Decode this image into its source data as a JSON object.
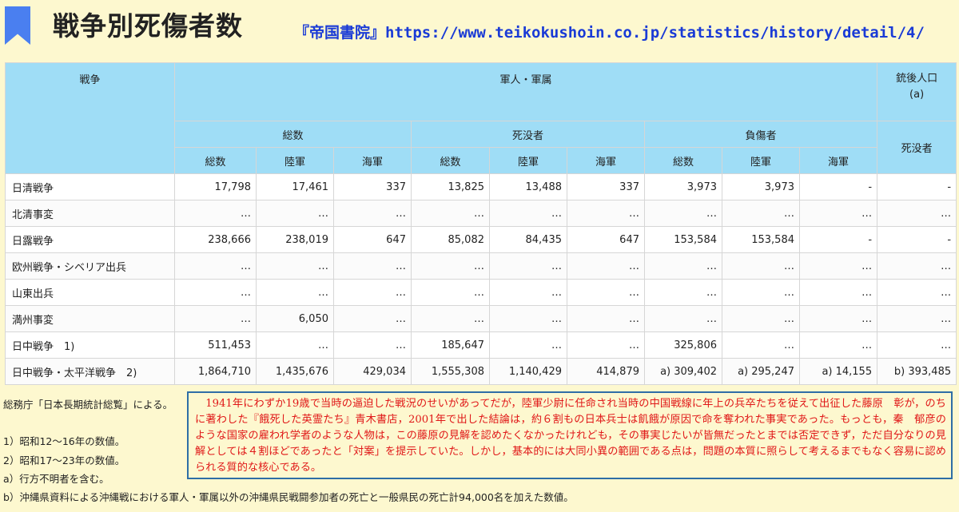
{
  "header": {
    "title": "戦争別死傷者数",
    "source": "『帝国書院』https://www.teikokushoin.co.jp/statistics/history/detail/4/"
  },
  "table": {
    "col_war": "戦争",
    "col_military": "軍人・軍属",
    "col_population_line1": "銃後人口",
    "col_population_line2": "(a)",
    "group_total": "総数",
    "group_dead": "死没者",
    "group_wounded": "負傷者",
    "pop_dead": "死没者",
    "sub": [
      "総数",
      "陸軍",
      "海軍",
      "総数",
      "陸軍",
      "海軍",
      "総数",
      "陸軍",
      "海軍"
    ],
    "rows": [
      {
        "name": "日清戦争",
        "cells": [
          "17,798",
          "17,461",
          "337",
          "13,825",
          "13,488",
          "337",
          "3,973",
          "3,973",
          "-",
          "-"
        ]
      },
      {
        "name": "北清事変",
        "cells": [
          "…",
          "…",
          "…",
          "…",
          "…",
          "…",
          "…",
          "…",
          "…",
          "…"
        ]
      },
      {
        "name": "日露戦争",
        "cells": [
          "238,666",
          "238,019",
          "647",
          "85,082",
          "84,435",
          "647",
          "153,584",
          "153,584",
          "-",
          "-"
        ]
      },
      {
        "name": "欧州戦争・シベリア出兵",
        "cells": [
          "…",
          "…",
          "…",
          "…",
          "…",
          "…",
          "…",
          "…",
          "…",
          "…"
        ]
      },
      {
        "name": "山東出兵",
        "cells": [
          "…",
          "…",
          "…",
          "…",
          "…",
          "…",
          "…",
          "…",
          "…",
          "…"
        ]
      },
      {
        "name": "満州事変",
        "cells": [
          "…",
          "6,050",
          "…",
          "…",
          "…",
          "…",
          "…",
          "…",
          "…",
          "…"
        ]
      },
      {
        "name": "日中戦争　1)",
        "cells": [
          "511,453",
          "…",
          "…",
          "185,647",
          "…",
          "…",
          "325,806",
          "…",
          "…",
          "…"
        ]
      },
      {
        "name": "日中戦争・太平洋戦争　2)",
        "cells": [
          "1,864,710",
          "1,435,676",
          "429,034",
          "1,555,308",
          "1,140,429",
          "414,879",
          "a) 309,402",
          "a) 295,247",
          "a) 14,155",
          "b) 393,485"
        ]
      }
    ]
  },
  "notes": {
    "source_note": "総務庁「日本長期統計総覧」による。",
    "note1": "1）昭和12～16年の数値。",
    "note2": "2）昭和17～23年の数値。",
    "note_a": "a）行方不明者を含む。",
    "note_b": "b）沖縄県資料による沖縄戦における軍人・軍属以外の沖縄県民戦闘参加者の死亡と一般県民の死亡計94,000名を加えた数値。"
  },
  "callout": {
    "text": "1941年にわずか19歳で当時の逼迫した戦況のせいがあってだが，陸軍少尉に任命され当時の中国戦線に年上の兵卒たちを従えて出征した藤原　彰が，のちに著わした『餓死した英霊たち』青木書店，2001年で出した結論は，約６割もの日本兵士は飢餓が原因で命を奪われた事実であった。もっとも，秦　郁彦のような国家の雇われ学者のような人物は，この藤原の見解を認めたくなかったけれども，その事実じたいが皆無だったとまでは否定できず，ただ自分なりの見解としては４割ほどであったと「対案」を提示していた。しかし，基本的には大同小異の範囲である点は，問題の本質に照らして考えるまでもなく容易に認められる質的な核心である。"
  },
  "colors": {
    "background": "#fdf8cf",
    "header_cell": "#9fddf6",
    "bookmark": "#4a7ff0",
    "source_link": "#1a3bd6",
    "callout_text": "#e01818",
    "callout_border": "#2e6ea6"
  }
}
